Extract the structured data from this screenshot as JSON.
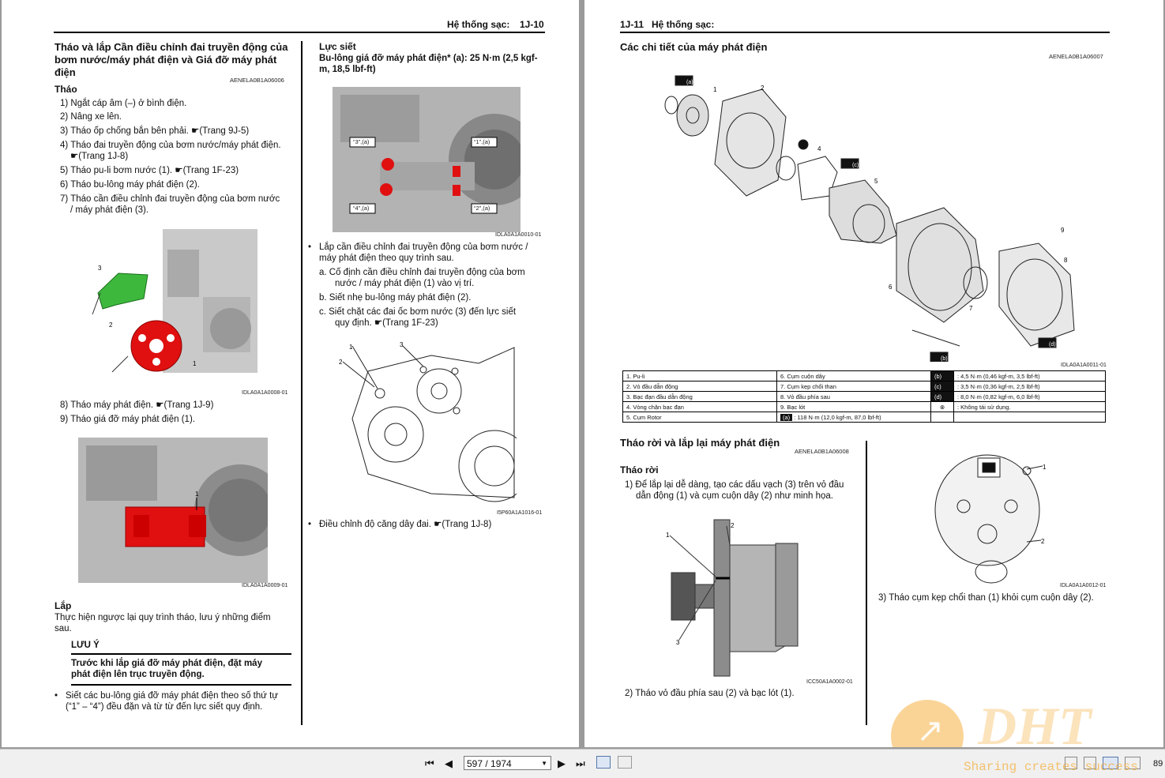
{
  "left_page": {
    "header": "Hệ thống sạc:",
    "page_num": "1J-10",
    "section_title": "Tháo và lắp Cần điều chỉnh đai truyền động của bơm nước/máy phát điện và Giá đỡ máy phát điện",
    "section_title_l1": "Tháo và lắp Cần điều chỉnh đai truyền động của",
    "section_title_l2": "bơm nước/máy phát điện và Giá đỡ máy phát",
    "section_title_l3": "điện",
    "section_code": "AENELA0B1A06006",
    "remove_heading": "Tháo",
    "steps": [
      "1) Ngắt cáp âm (–) ở bình điện.",
      "2) Nâng xe lên.",
      "3) Tháo ốp chống bắn bên phải. ☛(Trang 9J-5)",
      "4) Tháo đai truyền động của bơm nước/máy phát điện.",
      "☛(Trang 1J-8)",
      "5) Tháo pu-li bơm nước (1). ☛(Trang 1F-23)",
      "6) Tháo bu-lông máy phát điện (2).",
      "7) Tháo cần điều chỉnh đai truyền động của bơm nước",
      "/ máy phát điện (3)."
    ],
    "fig1_caption": "IDLA0A1A0008-01",
    "steps2": [
      "8) Tháo máy phát điện. ☛(Trang 1J-9)",
      "9) Tháo giá đỡ máy phát điện (1)."
    ],
    "fig2_caption": "IDLA0A1A0009-01",
    "install_heading": "Lắp",
    "install_text_l1": "Thực hiện ngược lại quy trình tháo, lưu ý những điểm",
    "install_text_l2": "sau.",
    "note_title": "LƯU Ý",
    "note_l1": "Trước khi lắp giá đỡ máy phát điện, đặt máy",
    "note_l2": "phát điện lên trục truyền động.",
    "bullet1_l1": "Siết các bu-lông giá đỡ máy phát điện theo số thứ tự",
    "bullet1_l2": "(“1” – “4”) đều đặn và từ từ đến lực siết quy định.",
    "torque_heading": "Lực siết",
    "torque_l1": "Bu-lông giá đỡ máy phát điện* (a): 25 N·m (2,5 kgf-",
    "torque_l2": "m, 18,5 lbf-ft)",
    "fig3_caption": "IDLA0A1A0010-01",
    "fig3_labels": [
      "“3”,(a)",
      "“1”,(a)",
      "“4”,(a)",
      "“2”,(a)"
    ],
    "bullet2_l1": "Lắp cần điều chỉnh đai truyền động của bơm nước /",
    "bullet2_l2": "máy phát điện theo quy trình sau.",
    "sub_a_l1": "a.   Cố định cần điều chỉnh đai truyền động của bơm",
    "sub_a_l2": "nước / máy phát điện (1) vào vị trí.",
    "sub_b": "b.   Siết nhẹ bu-lông máy phát điện (2).",
    "sub_c_l1": "c.   Siết chặt các đai ốc bơm nước (3) đến lực siết",
    "sub_c_l2": "quy định. ☛(Trang 1F-23)",
    "fig4_caption": "I5P60A1A1016-01",
    "bullet3": "Điều chỉnh độ căng dây đai. ☛(Trang 1J-8)"
  },
  "right_page": {
    "page_num": "1J-11",
    "header": "Hệ thống sạc:",
    "components_title": "Các chi tiết của máy phát điện",
    "components_code": "AENELA0B1A06007",
    "fig5_caption": "IDLA0A1A0011-01",
    "parts_rows": [
      [
        "1.   Pu-li",
        "6.   Cụm cuộn dây",
        "(b)",
        ":   4,5 N·m (0,46 kgf-m, 3,5 lbf-ft)"
      ],
      [
        "2.   Vỏ đầu dẫn động",
        "7.   Cụm kẹp chổi than",
        "(c)",
        ":   3,5 N·m (0,36 kgf-m, 2,5 lbf-ft)"
      ],
      [
        "3.   Bạc đạn đầu dẫn động",
        "8.   Vỏ đầu phía sau",
        "(d)",
        ":   8,0 N·m (0,82 kgf-m, 6,0 lbf-ft)"
      ],
      [
        "4.   Vòng chặn bạc đạn",
        "9.   Bạc lót",
        "⊗",
        ":   Không tái sử dụng."
      ],
      [
        "5.   Cụm Rotor",
        "(a)",
        ":   118 N·m (12,0 kgf-m, 87,0 lbf-ft)",
        ""
      ]
    ],
    "disassembly_title": "Tháo rời và lắp lại máy phát điện",
    "disassembly_code": "AENELA0B1A06008",
    "disassembly_heading": "Tháo rời",
    "d_step1_l1": "1) Để lắp lại dễ dàng, tạo các dấu vạch (3) trên vỏ đầu",
    "d_step1_l2": "dẫn động (1) và cụm cuộn dây (2) như minh họa.",
    "fig6_caption": "ICC50A1A0002-01",
    "d_step2": "2) Tháo vỏ đầu phía sau (2) và bạc lót (1).",
    "fig7_caption": "IDLA0A1A0012-01",
    "d_step3": "3) Tháo cụm kẹp chổi than (1) khỏi cụm cuộn dây (2)."
  },
  "toolbar": {
    "first_page": "⏮",
    "prev_page": "◀",
    "page_value": "597 / 1974",
    "next_page": "▶",
    "last_page": "⏭",
    "page_count_partial": "89"
  },
  "watermark": {
    "logo_text": "DHT",
    "slogan": "Sharing creates success"
  },
  "colors": {
    "highlight_red": "#e01010",
    "highlight_green": "#3db83d",
    "watermark_orange": "#f5b041"
  }
}
